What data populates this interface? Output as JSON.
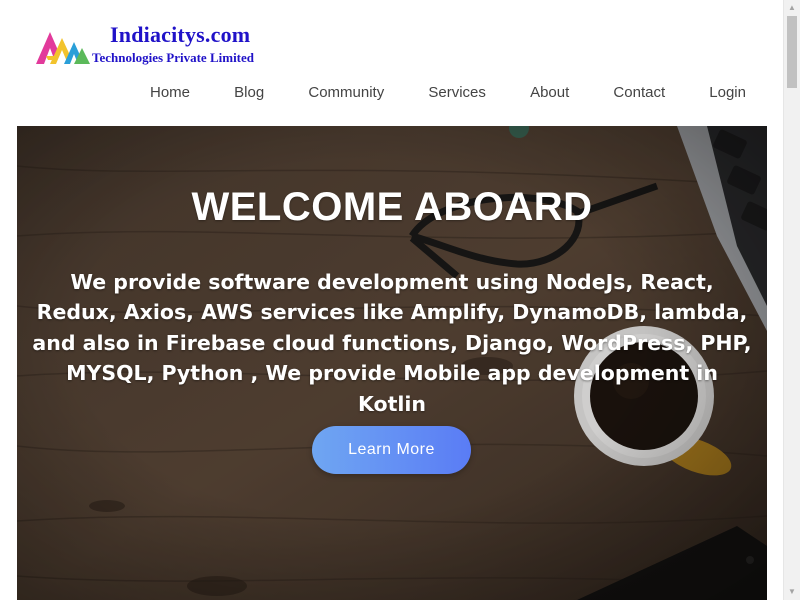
{
  "brand": {
    "title": "Indiacitys.com",
    "subtitle": "Technologies Private Limited",
    "colors": {
      "text": "#2012c8",
      "mark_magenta": "#e23a9b",
      "mark_yellow": "#f2c32c",
      "mark_blue": "#2a9fd8",
      "mark_green": "#5bb95a"
    }
  },
  "nav": {
    "items": [
      {
        "label": "Home"
      },
      {
        "label": "Blog"
      },
      {
        "label": "Community"
      },
      {
        "label": "Services"
      },
      {
        "label": "About"
      },
      {
        "label": "Contact"
      },
      {
        "label": "Login"
      }
    ]
  },
  "hero": {
    "title": "WELCOME ABOARD",
    "text": "We provide software development using NodeJs, React, Redux, Axios, AWS services like Amplify, DynamoDB, lambda, and also in Firebase cloud functions, Django, WordPress, PHP, MYSQL, Python , We provide Mobile app development in Kotlin",
    "button_label": "Learn More",
    "background_description_icons": [
      "laptop-icon",
      "glasses-icon",
      "coffee-cup-icon",
      "phone-icon"
    ],
    "button_gradient": [
      "#6fa6f2",
      "#5a7cf5"
    ]
  },
  "scrollbar": {
    "up_icon": "scroll-up-arrow-icon",
    "down_icon": "scroll-down-arrow-icon"
  }
}
